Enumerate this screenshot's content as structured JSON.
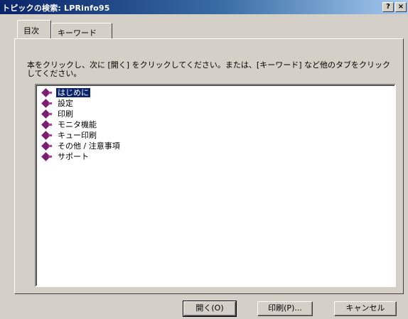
{
  "window": {
    "title": "トピックの検索: LPRinfo95",
    "help_label": "?",
    "close_label": "×"
  },
  "tabs": [
    {
      "label": "目次"
    },
    {
      "label": "キーワード"
    }
  ],
  "instruction": "本をクリックし、次に [開く] をクリックしてください。または、[キーワード] など他のタブをクリックしてください。",
  "topics": [
    {
      "label": "はじめに",
      "icon": "book-icon",
      "selected": true
    },
    {
      "label": "設定",
      "icon": "book-icon"
    },
    {
      "label": "印刷",
      "icon": "book-icon"
    },
    {
      "label": "モニタ機能",
      "icon": "book-icon"
    },
    {
      "label": "キュー印刷",
      "icon": "book-icon"
    },
    {
      "label": "その他 / 注意事項",
      "icon": "book-icon"
    },
    {
      "label": "サポート",
      "icon": "book-icon"
    }
  ],
  "buttons": {
    "open": "開く(O)",
    "print": "印刷(P)...",
    "cancel": "キャンセル"
  }
}
